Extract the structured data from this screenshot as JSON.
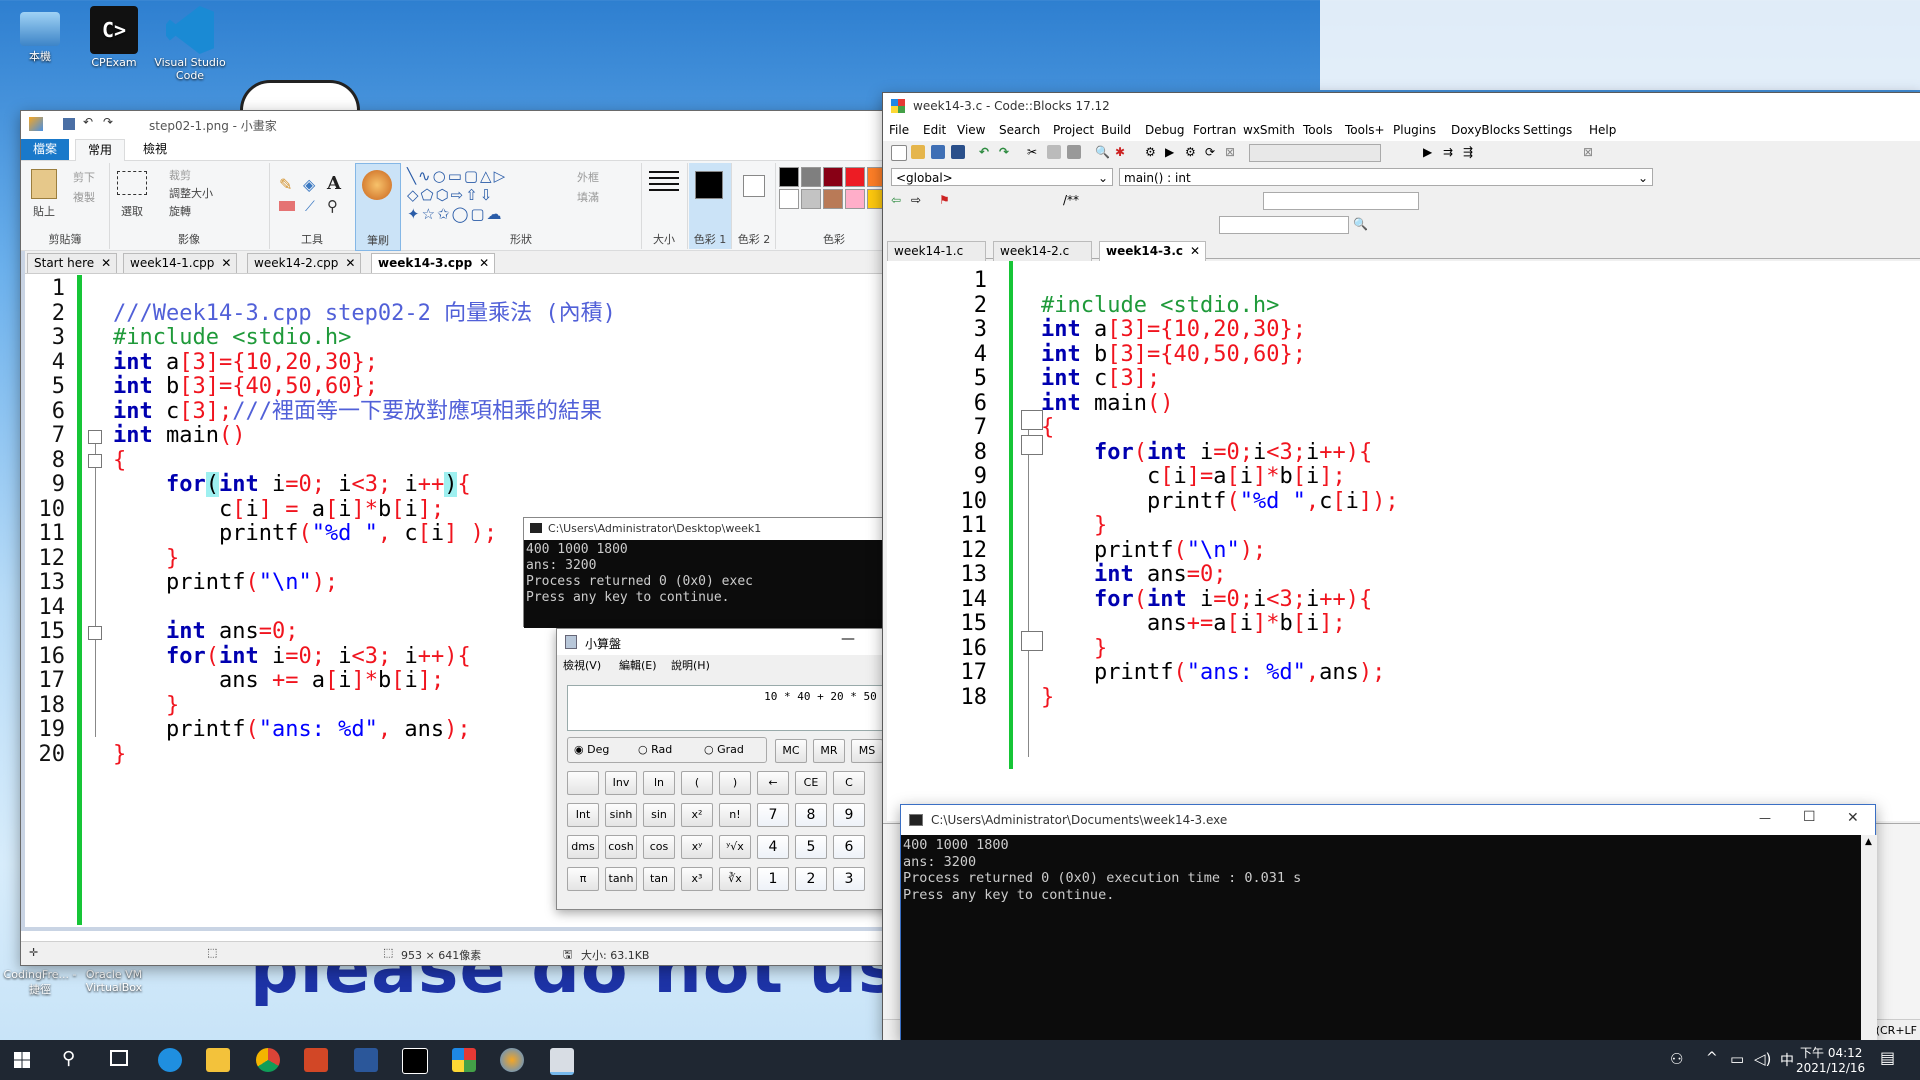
{
  "desktop": {
    "icons": [
      {
        "label": "本機"
      },
      {
        "label": "CPExam"
      },
      {
        "label": "Visual Studio Code"
      },
      {
        "label": "CodingFre... - 捷徑"
      },
      {
        "label": "Oracle VM VirtualBox"
      }
    ],
    "banner_text": "please do not use"
  },
  "paint": {
    "title": "step02-1.png - 小畫家",
    "tabs": [
      "檔案",
      "常用",
      "檢視"
    ],
    "groups": {
      "clipboard": {
        "paste": "貼上",
        "cut": "剪下",
        "copy": "複製",
        "label": "剪貼簿"
      },
      "image": {
        "select": "選取",
        "crop": "裁剪",
        "resize": "調整大小",
        "rotate": "旋轉",
        "label": "影像"
      },
      "tools": {
        "label": "工具"
      },
      "brushes": {
        "label": "筆刷"
      },
      "shapes": {
        "outline": "外框",
        "fill": "填滿",
        "label": "形狀"
      },
      "size": {
        "label": "大小"
      },
      "color1": {
        "label": "色彩 1"
      },
      "color2": {
        "label": "色彩 2"
      },
      "colors": {
        "label": "色彩"
      }
    },
    "status": {
      "dimensions": "953 × 641像素",
      "size": "大小: 63.1KB"
    }
  },
  "editor_left": {
    "tabs": [
      "Start here",
      "week14-1.cpp",
      "week14-2.cpp",
      "week14-3.cpp"
    ],
    "active_tab": "week14-3.cpp",
    "line_numbers": [
      "1",
      "2",
      "3",
      "4",
      "5",
      "6",
      "7",
      "8",
      "9",
      "10",
      "11",
      "12",
      "13",
      "14",
      "15",
      "16",
      "17",
      "18",
      "19",
      "20"
    ]
  },
  "console_left": {
    "title": "C:\\Users\\Administrator\\Desktop\\week1",
    "lines": [
      "400 1000 1800",
      "ans: 3200",
      "Process returned 0 (0x0)   exec",
      "Press any key to continue."
    ]
  },
  "calculator": {
    "title": "小算盤",
    "menu": [
      "檢視(V)",
      "編輯(E)",
      "說明(H)"
    ],
    "display": "10 * 40 + 20 * 50 +",
    "modes": [
      "Deg",
      "Rad",
      "Grad"
    ],
    "mem": [
      "MC",
      "MR",
      "MS"
    ],
    "rows": [
      [
        "",
        "Inv",
        "ln",
        "(",
        ")",
        "←",
        "CE",
        "C"
      ],
      [
        "Int",
        "sinh",
        "sin",
        "x²",
        "n!",
        "7",
        "8",
        "9"
      ],
      [
        "dms",
        "cosh",
        "cos",
        "xʸ",
        "ʸ√x",
        "4",
        "5",
        "6"
      ],
      [
        "π",
        "tanh",
        "tan",
        "x³",
        "∛x",
        "1",
        "2",
        "3"
      ]
    ]
  },
  "codeblocks": {
    "title": "week14-3.c - Code::Blocks 17.12",
    "menu": [
      "File",
      "Edit",
      "View",
      "Search",
      "Project",
      "Build",
      "Debug",
      "Fortran",
      "wxSmith",
      "Tools",
      "Tools+",
      "Plugins",
      "DoxyBlocks",
      "Settings",
      "Help"
    ],
    "scope": "<global>",
    "function": "main() : int",
    "tabs": [
      "week14-1.c",
      "week14-2.c",
      "week14-3.c"
    ],
    "active_tab": "week14-3.c",
    "line_numbers": [
      "1",
      "2",
      "3",
      "4",
      "5",
      "6",
      "7",
      "8",
      "9",
      "10",
      "11",
      "12",
      "13",
      "14",
      "15",
      "16",
      "17",
      "18"
    ],
    "status_right": "(CR+LF"
  },
  "console_right": {
    "title": "C:\\Users\\Administrator\\Documents\\week14-3.exe",
    "lines": [
      "400 1000 1800",
      "ans: 3200",
      "Process returned 0 (0x0)   execution time : 0.031 s",
      "Press any key to continue."
    ]
  },
  "taskbar": {
    "time": "下午 04:12",
    "date": "2021/12/16",
    "ime": "中"
  }
}
